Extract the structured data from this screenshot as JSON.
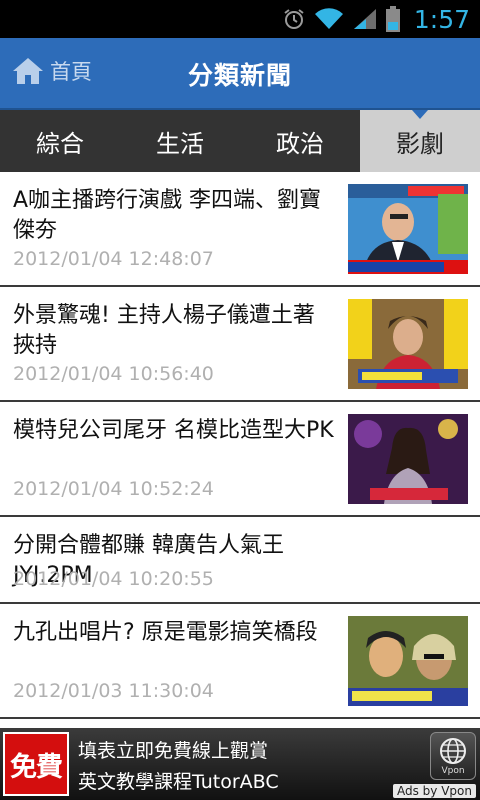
{
  "status_bar": {
    "time": "1:57"
  },
  "header": {
    "home_label": "首頁",
    "title": "分類新聞"
  },
  "tabs": [
    {
      "label": "綜合"
    },
    {
      "label": "生活"
    },
    {
      "label": "政治"
    },
    {
      "label": "影劇",
      "active": true
    }
  ],
  "news": [
    {
      "title": "A咖主播跨行演戲 李四端、劉寶傑夯",
      "date": "2012/01/04 12:48:07",
      "has_thumb": true
    },
    {
      "title": "外景驚魂! 主持人楊子儀遭土著挾持",
      "date": "2012/01/04 10:56:40",
      "has_thumb": true
    },
    {
      "title": "模特兒公司尾牙 名模比造型大PK",
      "date": "2012/01/04 10:52:24",
      "has_thumb": true
    },
    {
      "title": "分開合體都賺 韓廣告人氣王JYJ.2PM",
      "date": "2012/01/04 10:20:55",
      "has_thumb": false
    },
    {
      "title": "九孔出唱片? 原是電影搞笑橋段",
      "date": "2012/01/03 11:30:04",
      "has_thumb": true
    }
  ],
  "ad": {
    "badge": "免費",
    "line1": "填表立即免費線上觀賞",
    "line2": "英文教學課程TutorABC",
    "vpon_label": "Vpon",
    "attribution": "Ads by Vpon"
  },
  "colors": {
    "header": "#2d6cb9",
    "tab_bar": "#333333",
    "active_tab": "#cfcfcf",
    "clock": "#33b5e5",
    "ad_badge": "#d40e0e"
  }
}
